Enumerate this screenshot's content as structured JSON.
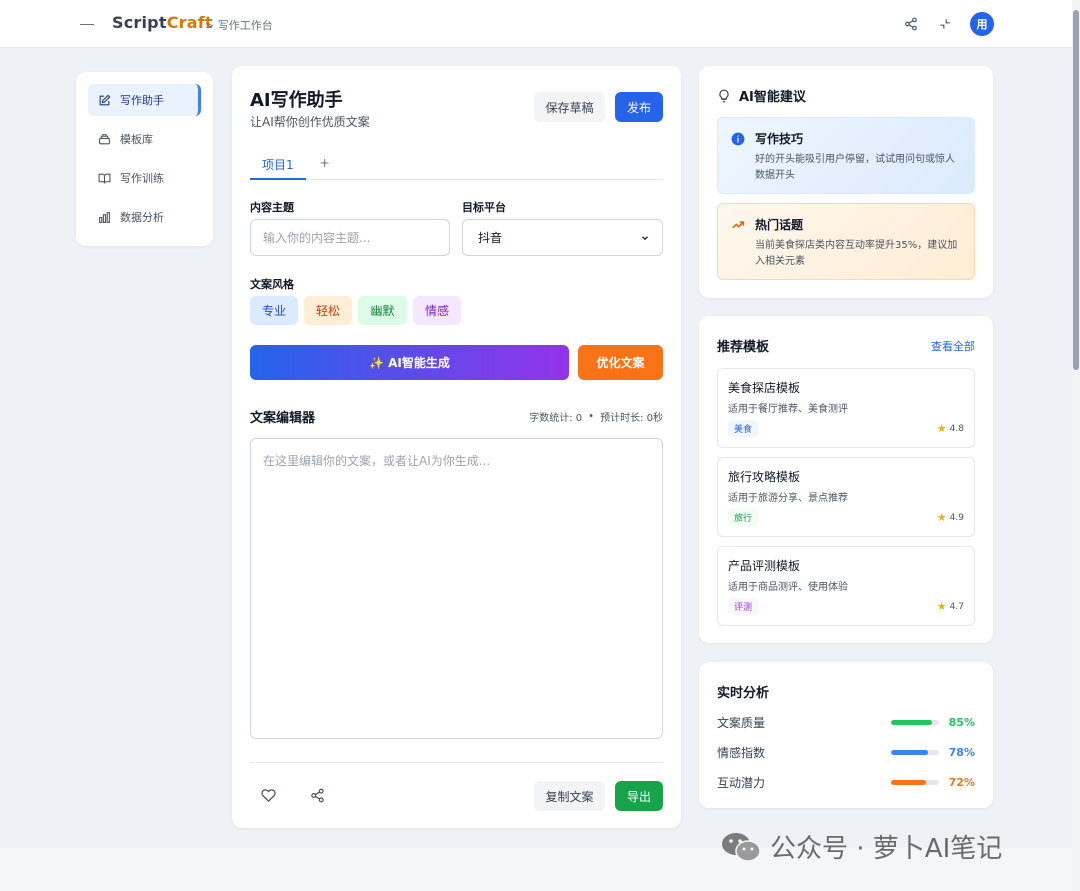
{
  "header": {
    "logo_script": "Script",
    "logo_craft": "Craft",
    "breadcrumb": "> 写作工作台",
    "avatar": "用"
  },
  "sidebar": {
    "items": [
      {
        "label": "写作助手",
        "icon": "edit-icon"
      },
      {
        "label": "模板库",
        "icon": "layers-icon"
      },
      {
        "label": "写作训练",
        "icon": "book-icon"
      },
      {
        "label": "数据分析",
        "icon": "bar-chart-icon"
      }
    ]
  },
  "main": {
    "title": "AI写作助手",
    "subtitle": "让AI帮你创作优质文案",
    "save_draft": "保存草稿",
    "publish": "发布",
    "tabs": [
      {
        "label": "项目1"
      }
    ],
    "tab_add": "+",
    "topic_label": "内容主题",
    "topic_placeholder": "输入你的内容主题...",
    "platform_label": "目标平台",
    "platform_value": "抖音",
    "style_label": "文案风格",
    "styles": [
      "专业",
      "轻松",
      "幽默",
      "情感"
    ],
    "generate": "AI智能生成",
    "optimize": "优化文案",
    "editor_title": "文案编辑器",
    "word_count": "字数统计: 0",
    "duration": "预计时长: 0秒",
    "editor_placeholder": "在这里编辑你的文案，或者让AI为你生成...",
    "copy": "复制文案",
    "export": "导出"
  },
  "ai_panel": {
    "title": "AI智能建议",
    "tips": [
      {
        "title": "写作技巧",
        "body": "好的开头能吸引用户停留，试试用问句或惊人数据开头"
      },
      {
        "title": "热门话题",
        "body": "当前美食探店类内容互动率提升35%，建议加入相关元素"
      }
    ]
  },
  "templates": {
    "title": "推荐模板",
    "view_all": "查看全部",
    "items": [
      {
        "name": "美食探店模板",
        "desc": "适用于餐厅推荐、美食测评",
        "tag": "美食",
        "rating": "4.8"
      },
      {
        "name": "旅行攻略模板",
        "desc": "适用于旅游分享、景点推荐",
        "tag": "旅行",
        "rating": "4.9"
      },
      {
        "name": "产品评测模板",
        "desc": "适用于商品测评、使用体验",
        "tag": "评测",
        "rating": "4.7"
      }
    ]
  },
  "analytics": {
    "title": "实时分析",
    "items": [
      {
        "label": "文案质量",
        "value": "85%",
        "level": 0.85,
        "color": "#22c55e"
      },
      {
        "label": "情感指数",
        "value": "78%",
        "level": 0.78,
        "color": "#3b82f6"
      },
      {
        "label": "互动潜力",
        "value": "72%",
        "level": 0.72,
        "color": "#f97316"
      }
    ]
  },
  "watermark": "公众号 · 萝卜AI笔记"
}
